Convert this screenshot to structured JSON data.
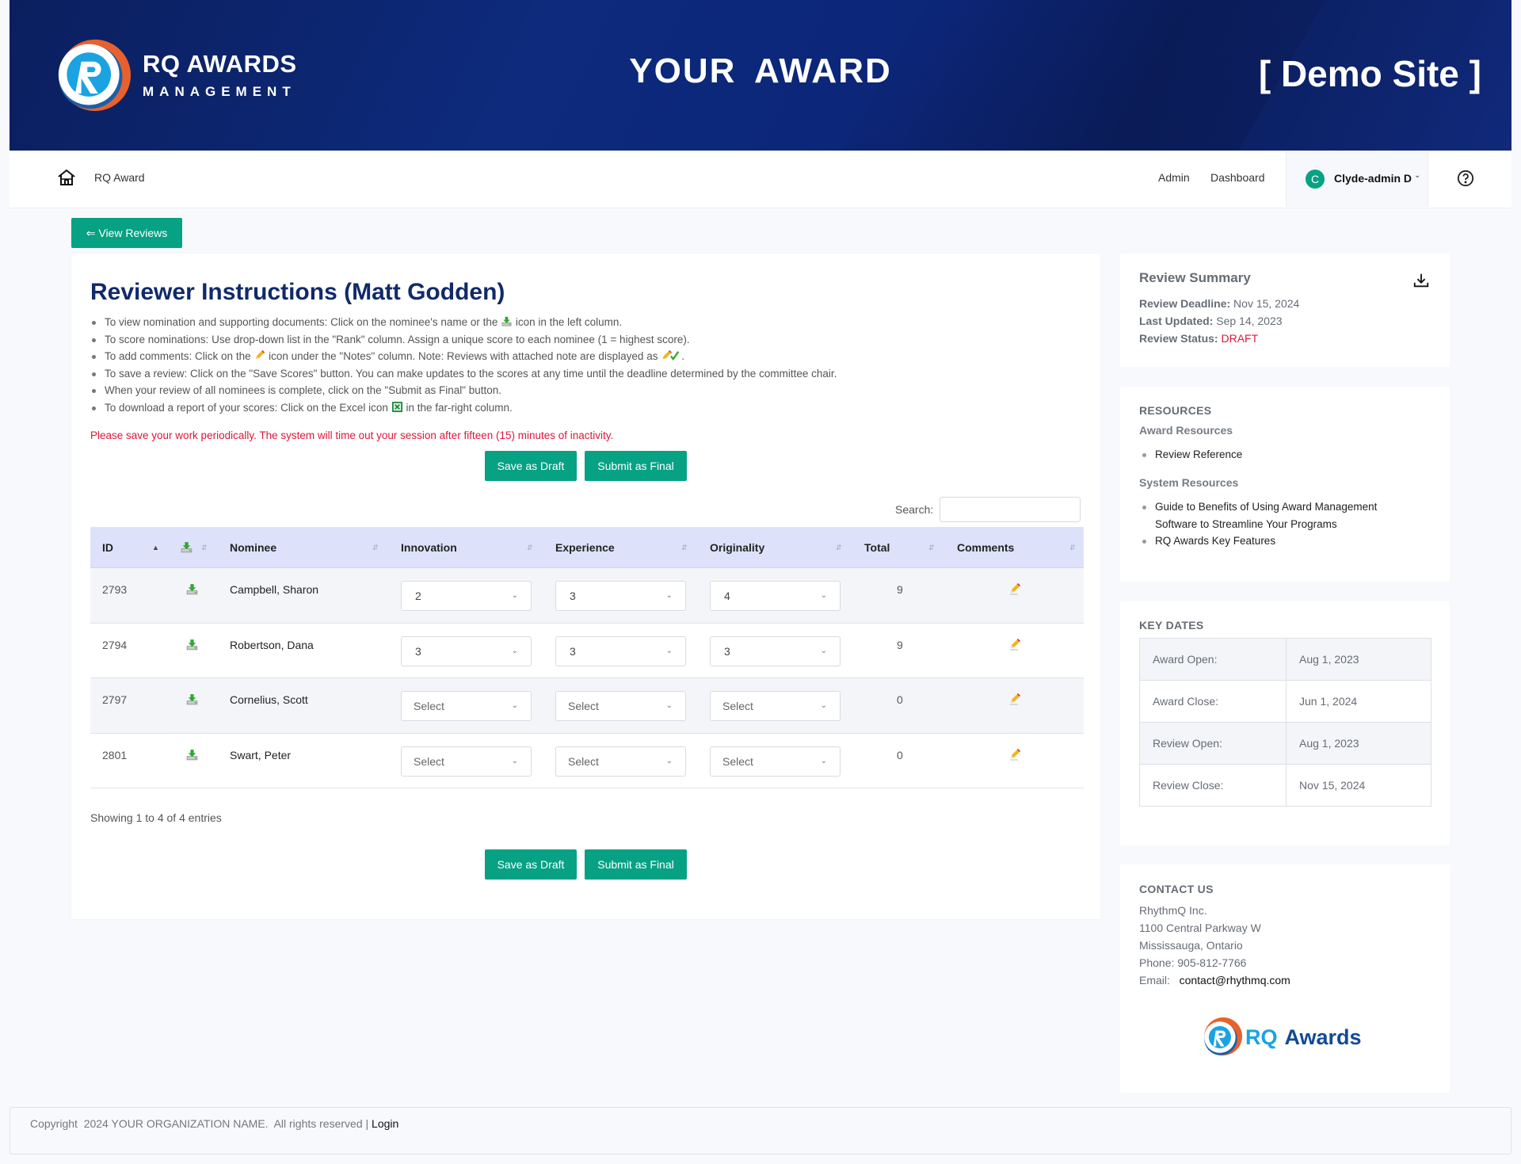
{
  "banner": {
    "logo_title": "RQ AWARDS",
    "logo_subtitle": "MANAGEMENT",
    "title": "YOUR  AWARD",
    "site_label": "[ Demo Site ]"
  },
  "navbar": {
    "brand": "RQ Award",
    "links": [
      "Admin",
      "Dashboard"
    ],
    "user": {
      "initial": "C",
      "name": "Clyde-admin D"
    },
    "icons": {
      "home": "home-icon",
      "help": "help-circle-icon",
      "caret": "chevron-down-icon"
    }
  },
  "back_button": "⇐ View Reviews",
  "main": {
    "title": "Reviewer Instructions (Matt Godden)",
    "instructions": [
      {
        "before": "To view nomination and supporting documents: Click on the nominee's name or the ",
        "icon": "download-tray-icon",
        "after": " icon in the left column."
      },
      {
        "before": "To score nominations: Use drop-down list in the \"Rank\" column.  Assign a unique score to each nominee (1 =  highest score).",
        "icon": null,
        "after": ""
      },
      {
        "before": "To add comments: Click on the ",
        "icon": "pencil-icon",
        "after": " icon under the \"Notes\" column.  Note: Reviews with attached note are displayed as ",
        "icon2": "pencil-check-icon",
        "after2": "."
      },
      {
        "before": "To save a review: Click on the \"Save Scores\" button.  You can make updates to the scores at any time until the deadline determined by the committee chair.",
        "icon": null,
        "after": ""
      },
      {
        "before": "When your review of all nominees is complete, click on the \"Submit as Final\" button.",
        "icon": null,
        "after": ""
      },
      {
        "before": "To download a report of your scores: Click on the Excel icon ",
        "icon": "excel-icon",
        "after": " in the far-right column."
      }
    ],
    "warning": "Please save your work periodically. The system will time out your session after fifteen (15) minutes of inactivity.",
    "save_draft_label": "Save as Draft",
    "submit_final_label": "Submit as Final",
    "search_label": "Search:",
    "search_value": "",
    "table": {
      "columns": [
        "ID",
        "",
        "Nominee",
        "Innovation",
        "Experience",
        "Originality",
        "Total",
        "Comments"
      ],
      "rows": [
        {
          "id": "2793",
          "nominee": "Campbell, Sharon",
          "innovation": "2",
          "experience": "3",
          "originality": "4",
          "total": "9"
        },
        {
          "id": "2794",
          "nominee": "Robertson, Dana",
          "innovation": "3",
          "experience": "3",
          "originality": "3",
          "total": "9"
        },
        {
          "id": "2797",
          "nominee": "Cornelius, Scott",
          "innovation": "Select",
          "experience": "Select",
          "originality": "Select",
          "total": "0"
        },
        {
          "id": "2801",
          "nominee": "Swart, Peter",
          "innovation": "Select",
          "experience": "Select",
          "originality": "Select",
          "total": "0"
        }
      ]
    },
    "showing": "Showing 1 to 4 of 4 entries"
  },
  "summary": {
    "title": "Review Summary",
    "deadline_label": "Review Deadline:",
    "deadline": "Nov 15, 2024",
    "updated_label": "Last Updated:",
    "updated": "Sep 14, 2023",
    "status_label": "Review Status:",
    "status": "DRAFT",
    "status_color": "#e0163a"
  },
  "resources": {
    "title": "RESOURCES",
    "award_heading": "Award Resources",
    "award_items": [
      "Review Reference"
    ],
    "system_heading": "System Resources",
    "system_items": [
      "Guide to Benefits of Using Award Management Software to Streamline Your Programs",
      "RQ Awards Key Features"
    ]
  },
  "key_dates": {
    "title": "KEY DATES",
    "rows": [
      {
        "label": "Award Open:",
        "value": "Aug 1, 2023"
      },
      {
        "label": "Award Close:",
        "value": "Jun 1, 2024"
      },
      {
        "label": "Review Open:",
        "value": "Aug 1, 2023"
      },
      {
        "label": "Review Close:",
        "value": "Nov 15, 2024"
      }
    ]
  },
  "contact": {
    "title": "CONTACT US",
    "company": "RhythmQ Inc.",
    "address1": "1100 Central Parkway W",
    "address2": "Mississauga, Ontario",
    "phone": "Phone: 905-812-7766",
    "email_label": "Email:",
    "email": "contact@rhythmq.com",
    "logo_text_rq": "RQ",
    "logo_text_awards": "Awards"
  },
  "footer": {
    "copyright": "Copyright  2024 YOUR ORGANIZATION NAME.  All rights reserved | ",
    "login": "Login"
  },
  "colors": {
    "accent": "#07a184",
    "banner": "#0d2a7c",
    "title": "#102a6a",
    "warning": "#e0163a",
    "table_header": "#dde2fa"
  }
}
